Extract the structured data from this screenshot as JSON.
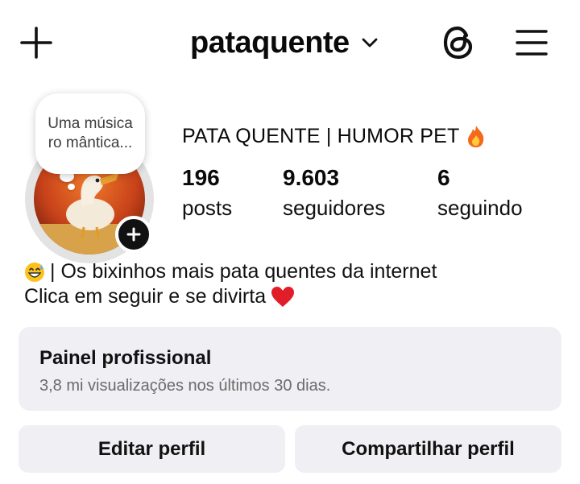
{
  "header": {
    "username": "pataquente",
    "icons": {
      "create": "plus-icon",
      "switch": "chevron-down-icon",
      "threads": "threads-icon",
      "menu": "hamburger-menu-icon"
    }
  },
  "profile": {
    "note": "Uma música ro mântica...",
    "display_name": "PATA QUENTE | HUMOR PET",
    "display_name_emoji": "fire-emoji",
    "stats": [
      {
        "value": "196",
        "label": "posts"
      },
      {
        "value": "9.603",
        "label": "seguidores"
      },
      {
        "value": "6",
        "label": "seguindo"
      }
    ],
    "bio": {
      "line1": "| Os bixinhos mais pata quentes da internet",
      "line1_emoji": "grinning-sweat-emoji",
      "line2": "Clica em seguir e se divirta",
      "line2_emoji": "red-heart-emoji"
    }
  },
  "professional_dashboard": {
    "title": "Painel profissional",
    "subtitle": "3,8 mi visualizações nos últimos 30 dias."
  },
  "actions": {
    "edit_profile": "Editar perfil",
    "share_profile": "Compartilhar perfil"
  },
  "colors": {
    "panel_bg": "#efeff4",
    "text": "#0a0a0a",
    "muted": "#6b6b6b"
  }
}
